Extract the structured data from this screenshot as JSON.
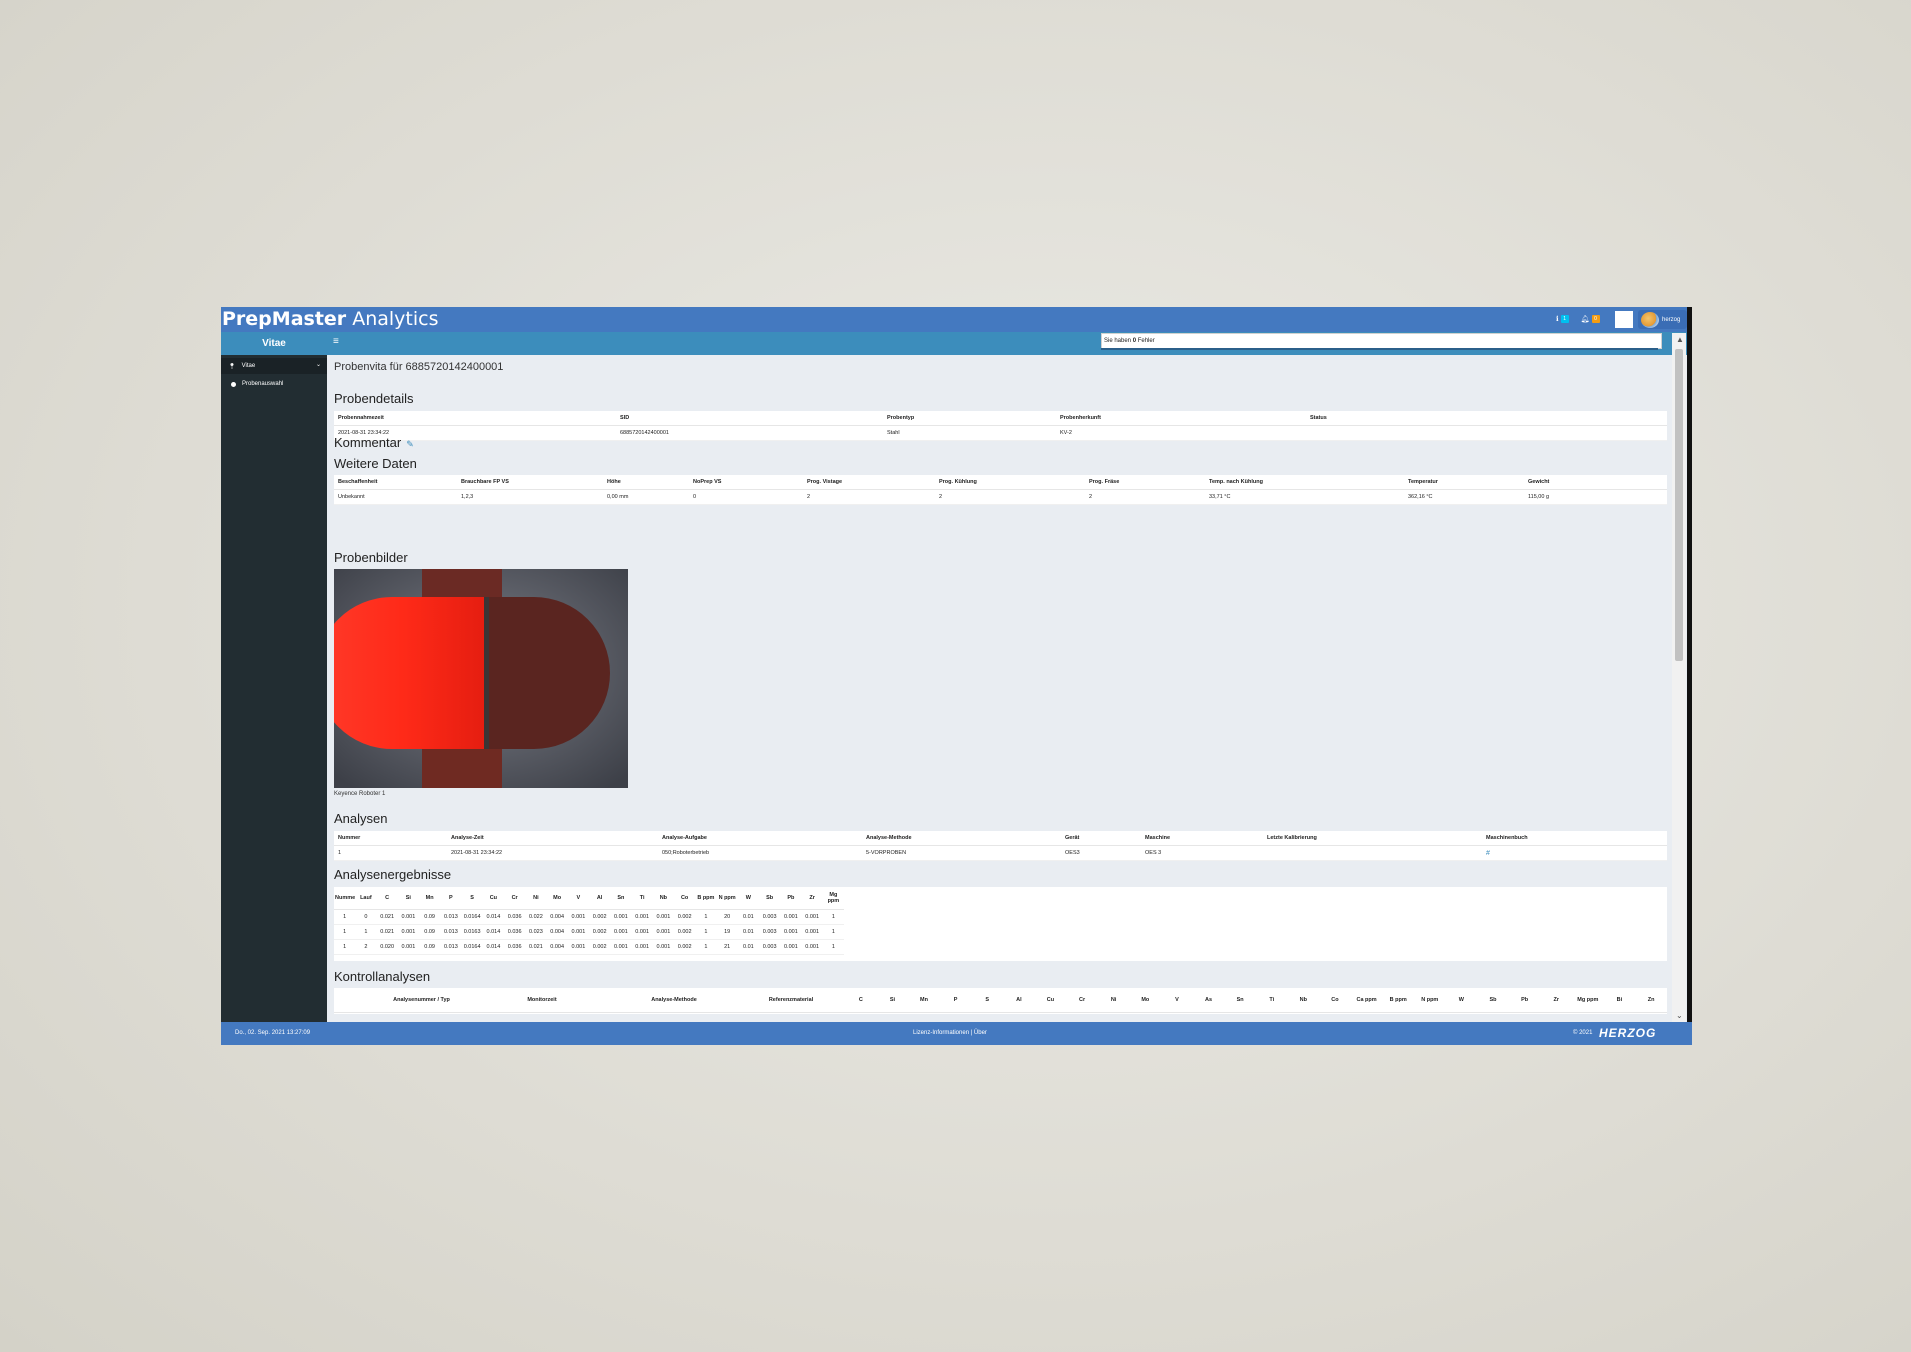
{
  "app": {
    "brand_bold": "PrepMaster",
    "brand_light": "Analytics",
    "user": "herzog"
  },
  "topbar": {
    "badge_info": "1",
    "badge_warn": "0"
  },
  "sidebar": {
    "header": "Vitae",
    "items": [
      {
        "label": "Vitae"
      }
    ],
    "subitems": [
      {
        "label": "Probenauswahl"
      }
    ]
  },
  "notification": {
    "prefix": "Sie haben",
    "count": "0",
    "suffix": "Fehler"
  },
  "page": {
    "title": "Probenvita für 6885720142400001"
  },
  "probendetails": {
    "heading": "Probendetails",
    "columns": [
      "Probennahmezeit",
      "SID",
      "Probentyp",
      "Probenherkunft",
      "Status"
    ],
    "row": [
      "2021-08-31 23:34:22",
      "6885720142400001",
      "Stahl",
      "KV-2",
      ""
    ]
  },
  "kommentar": {
    "heading": "Kommentar"
  },
  "weitere": {
    "heading": "Weitere Daten",
    "columns": [
      "Beschaffenheit",
      "Brauchbare FP VS",
      "Höhe",
      "NoPrep VS",
      "Prog. Vistage",
      "Prog. Kühlung",
      "Prog. Fräse",
      "Temp. nach Kühlung",
      "Temperatur",
      "Gewicht"
    ],
    "row": [
      "Unbekannt",
      "1,2,3",
      "0,00 mm",
      "0",
      "2",
      "2",
      "2",
      "33,71 °C",
      "362,16 °C",
      "115,00 g"
    ]
  },
  "bilder": {
    "heading": "Probenbilder",
    "caption": "Keyence Roboter 1"
  },
  "analysen": {
    "heading": "Analysen",
    "columns": [
      "Nummer",
      "Analyse-Zeit",
      "Analyse-Aufgabe",
      "Analyse-Methode",
      "Gerät",
      "Maschine",
      "Letzte Kalibrierung",
      "Maschinenbuch"
    ],
    "row": [
      "1",
      "2021-08-31 23:34:22",
      "050;Roboterbetrieb",
      "5-VORPROBEN",
      "OES3",
      "OES 3",
      "",
      "#"
    ]
  },
  "ergebnisse": {
    "heading": "Analysenergebnisse",
    "columns": [
      "Nummer",
      "Lauf",
      "C",
      "Si",
      "Mn",
      "P",
      "S",
      "Cu",
      "Cr",
      "Ni",
      "Mo",
      "V",
      "Al",
      "Sn",
      "Ti",
      "Nb",
      "Co",
      "B ppm",
      "N ppm",
      "W",
      "Sb",
      "Pb",
      "Zr",
      "Mg ppm"
    ],
    "rows": [
      [
        "1",
        "0",
        "0.021",
        "0.001",
        "0.09",
        "0.013",
        "0.0164",
        "0.014",
        "0.036",
        "0.022",
        "0.004",
        "0.001",
        "0.002",
        "0.001",
        "0.001",
        "0.001",
        "0.002",
        "1",
        "20",
        "0.01",
        "0.003",
        "0.001",
        "0.001",
        "1"
      ],
      [
        "1",
        "1",
        "0.021",
        "0.001",
        "0.09",
        "0.013",
        "0.0163",
        "0.014",
        "0.036",
        "0.023",
        "0.004",
        "0.001",
        "0.002",
        "0.001",
        "0.001",
        "0.001",
        "0.002",
        "1",
        "19",
        "0.01",
        "0.003",
        "0.001",
        "0.001",
        "1"
      ],
      [
        "1",
        "2",
        "0.020",
        "0.001",
        "0.09",
        "0.013",
        "0.0164",
        "0.014",
        "0.036",
        "0.021",
        "0.004",
        "0.001",
        "0.002",
        "0.001",
        "0.001",
        "0.001",
        "0.002",
        "1",
        "21",
        "0.01",
        "0.003",
        "0.001",
        "0.001",
        "1"
      ]
    ]
  },
  "kontroll": {
    "heading": "Kontrollanalysen",
    "columns": [
      "Analysenummer / Typ",
      "Monitorzeit",
      "Analyse-Methode",
      "Referenzmaterial",
      "C",
      "Si",
      "Mn",
      "P",
      "S",
      "Al",
      "Cu",
      "Cr",
      "Ni",
      "Mo",
      "V",
      "As",
      "Sn",
      "Ti",
      "Nb",
      "Co",
      "Ca ppm",
      "B ppm",
      "N ppm",
      "W",
      "Sb",
      "Pb",
      "Zr",
      "Mg ppm",
      "Bi",
      "Zn"
    ]
  },
  "footer": {
    "datetime": "Do., 02. Sep. 2021 13:27:09",
    "links": "Lizenz-Informationen  |  Über",
    "copyright": "© 2021",
    "logo": "HERZOG"
  },
  "colors": {
    "topbar": "#4479c0",
    "navbar": "#3c8dbc",
    "sidebar": "#222d32",
    "content_bg": "#e9edf2"
  }
}
